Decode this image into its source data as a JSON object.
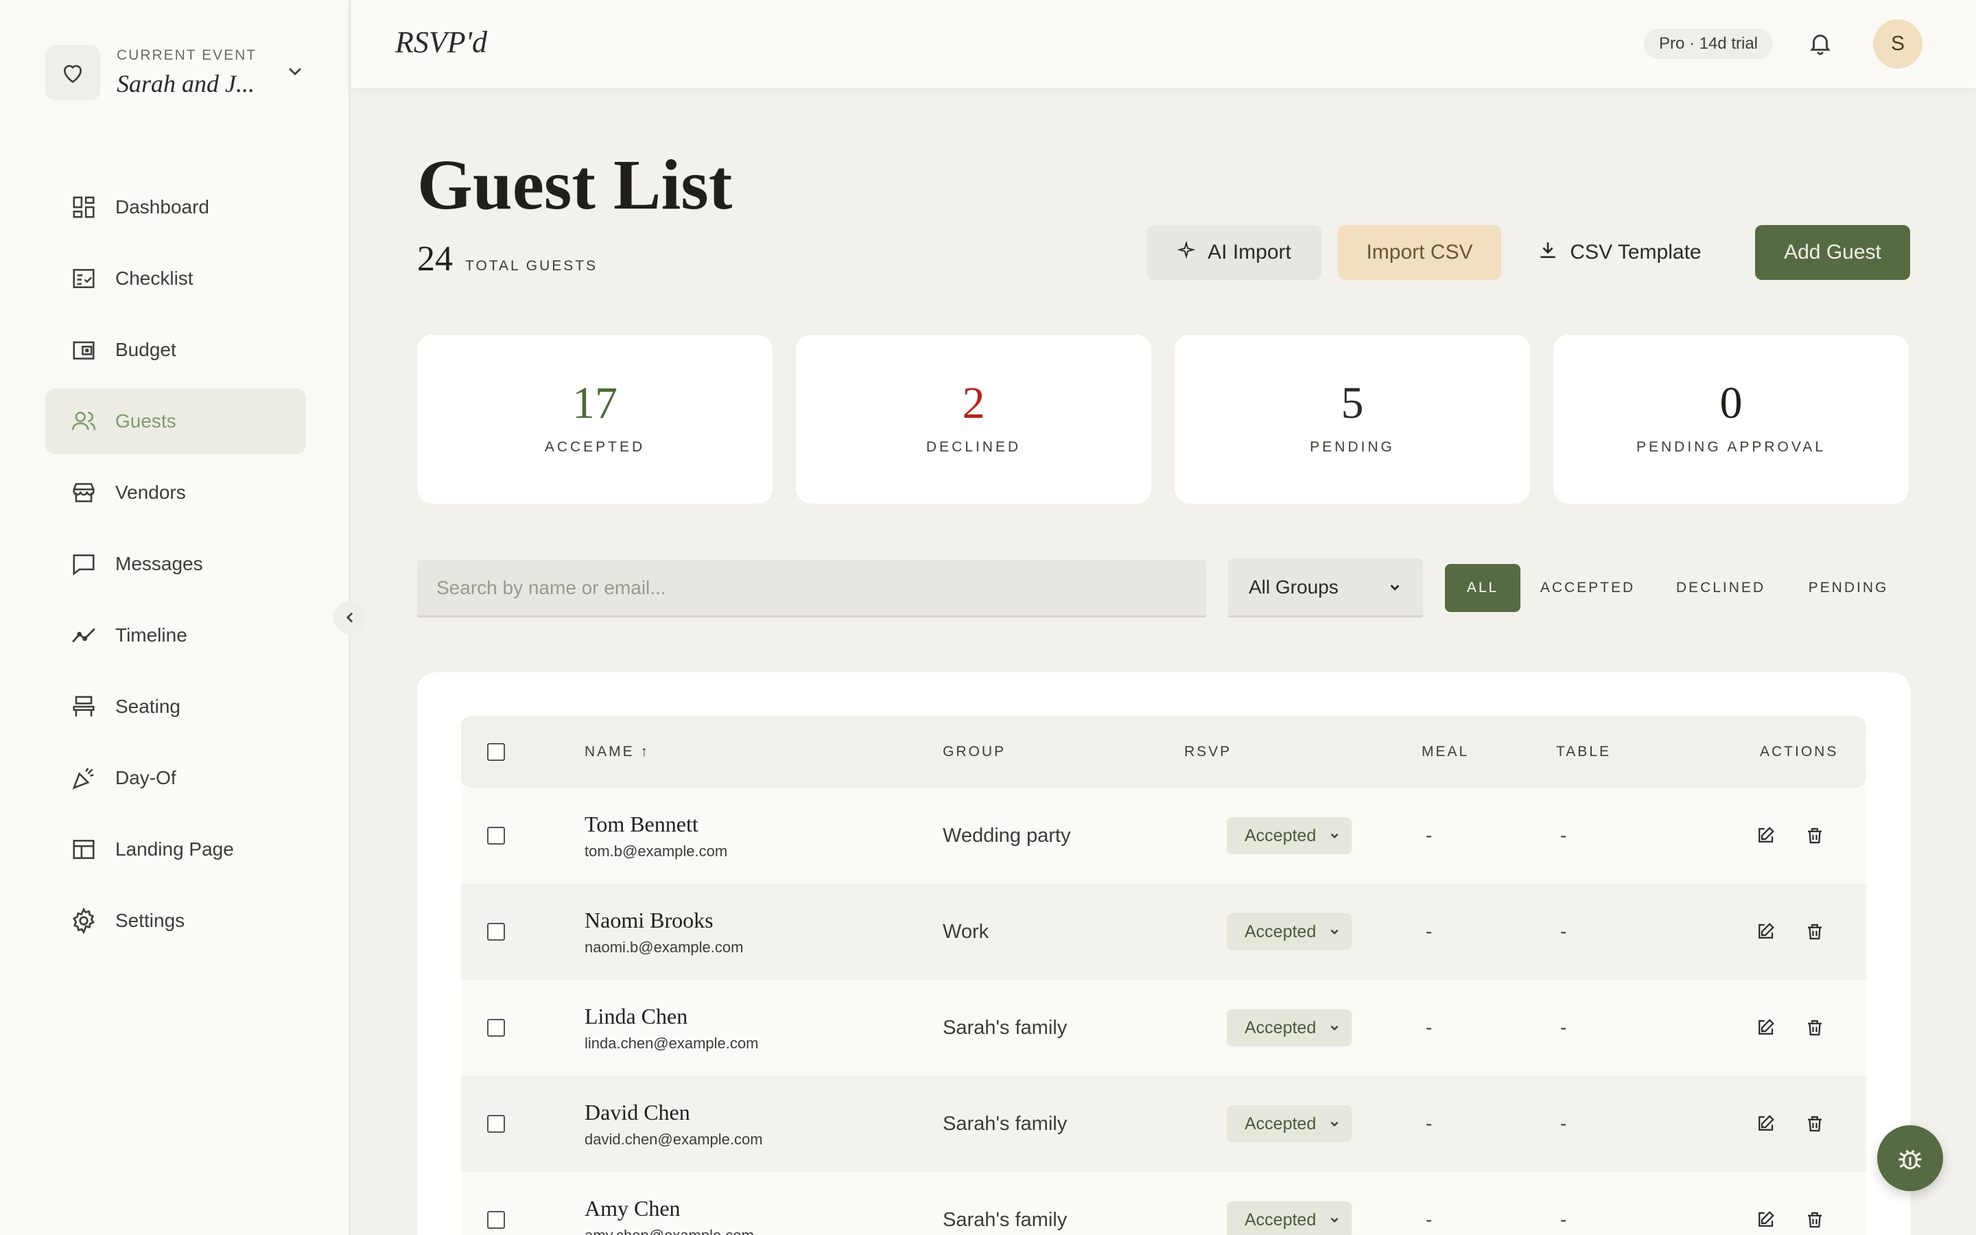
{
  "sidebar": {
    "current_event_label": "CURRENT EVENT",
    "current_event_name": "Sarah and J...",
    "items": [
      {
        "label": "Dashboard",
        "icon": "dashboard-icon"
      },
      {
        "label": "Checklist",
        "icon": "checklist-icon"
      },
      {
        "label": "Budget",
        "icon": "wallet-icon"
      },
      {
        "label": "Guests",
        "icon": "users-icon",
        "active": true
      },
      {
        "label": "Vendors",
        "icon": "store-icon"
      },
      {
        "label": "Messages",
        "icon": "message-icon"
      },
      {
        "label": "Timeline",
        "icon": "trend-icon"
      },
      {
        "label": "Seating",
        "icon": "chair-icon"
      },
      {
        "label": "Day-Of",
        "icon": "party-icon"
      },
      {
        "label": "Landing Page",
        "icon": "layout-icon"
      },
      {
        "label": "Settings",
        "icon": "gear-icon"
      }
    ]
  },
  "topbar": {
    "brand": "RSVP'd",
    "trial": "Pro · 14d trial",
    "avatar_initial": "S"
  },
  "page": {
    "title": "Guest List",
    "total_count": "24",
    "total_label": "TOTAL GUESTS"
  },
  "actions": {
    "ai_import": "AI Import",
    "import_csv": "Import CSV",
    "csv_template": "CSV Template",
    "add_guest": "Add Guest"
  },
  "stats": [
    {
      "value": "17",
      "label": "ACCEPTED",
      "color": "#4f6a3a"
    },
    {
      "value": "2",
      "label": "DECLINED",
      "color": "#b3261e"
    },
    {
      "value": "5",
      "label": "PENDING",
      "color": "#2a2a26"
    },
    {
      "value": "0",
      "label": "PENDING APPROVAL",
      "color": "#1f1f1c"
    }
  ],
  "filters": {
    "search_placeholder": "Search by name or email...",
    "group_selected": "All Groups",
    "tabs": [
      "ALL",
      "ACCEPTED",
      "DECLINED",
      "PENDING"
    ],
    "active_tab": "ALL"
  },
  "table": {
    "headers": {
      "name": "NAME ↑",
      "group": "GROUP",
      "rsvp": "RSVP",
      "meal": "MEAL",
      "table": "TABLE",
      "actions": "ACTIONS"
    },
    "rows": [
      {
        "name": "Tom Bennett",
        "email": "tom.b@example.com",
        "group": "Wedding party",
        "rsvp": "Accepted",
        "meal": "-",
        "table": "-"
      },
      {
        "name": "Naomi Brooks",
        "email": "naomi.b@example.com",
        "group": "Work",
        "rsvp": "Accepted",
        "meal": "-",
        "table": "-"
      },
      {
        "name": "Linda Chen",
        "email": "linda.chen@example.com",
        "group": "Sarah's family",
        "rsvp": "Accepted",
        "meal": "-",
        "table": "-"
      },
      {
        "name": "David Chen",
        "email": "david.chen@example.com",
        "group": "Sarah's family",
        "rsvp": "Accepted",
        "meal": "-",
        "table": "-"
      },
      {
        "name": "Amy Chen",
        "email": "amy.chen@example.com",
        "group": "Sarah's family",
        "rsvp": "Accepted",
        "meal": "-",
        "table": "-"
      }
    ]
  },
  "colors": {
    "accent": "#566a43",
    "accent_soft": "#f2dfc0",
    "background": "#f2f1ec"
  }
}
